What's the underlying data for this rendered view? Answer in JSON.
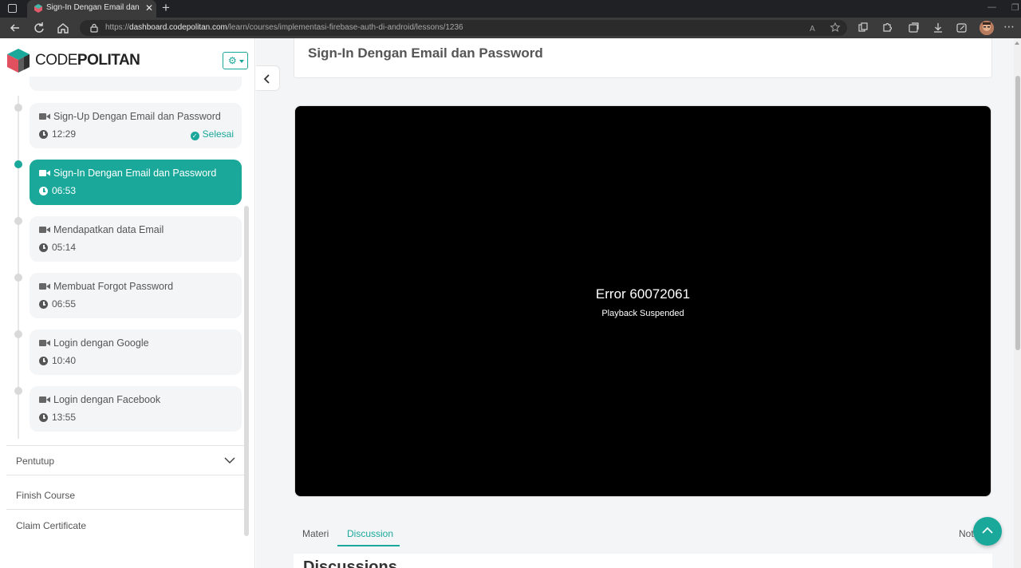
{
  "browser": {
    "tab_title": "Sign-In Dengan Email dan Passw",
    "new_tab_symbol": "+",
    "url_prefix": "https://",
    "url_domain": "dashboard.codepolitan.com",
    "url_path": "/learn/courses/implementasi-firebase-auth-di-android/lessons/1236"
  },
  "sidebar": {
    "logo_part1": "CODE",
    "logo_part2": "POLITAN",
    "lessons": [
      {
        "title": "Sign-Up Dengan Email dan Password",
        "duration": "12:29",
        "status": "Selesai",
        "active": false
      },
      {
        "title": "Sign-In Dengan Email dan Password",
        "duration": "06:53",
        "status": "",
        "active": true
      },
      {
        "title": "Mendapatkan data Email",
        "duration": "05:14",
        "status": "",
        "active": false
      },
      {
        "title": "Membuat Forgot Password",
        "duration": "06:55",
        "status": "",
        "active": false
      },
      {
        "title": "Login dengan Google",
        "duration": "10:40",
        "status": "",
        "active": false
      },
      {
        "title": "Login dengan Facebook",
        "duration": "13:55",
        "status": "",
        "active": false
      }
    ],
    "section": "Pentutup",
    "finish": "Finish Course",
    "certificate": "Claim Certificate"
  },
  "main": {
    "title": "Sign-In Dengan Email dan Password",
    "video_error": "Error 60072061",
    "video_error_sub": "Playback Suspended",
    "tabs": [
      "Materi",
      "Discussion",
      "Not"
    ],
    "active_tab": "Discussion",
    "discussion_heading": "Discussions"
  },
  "colors": {
    "accent": "#1aa89b",
    "browser_dark": "#202124",
    "main_bg": "#f4f5f7"
  }
}
